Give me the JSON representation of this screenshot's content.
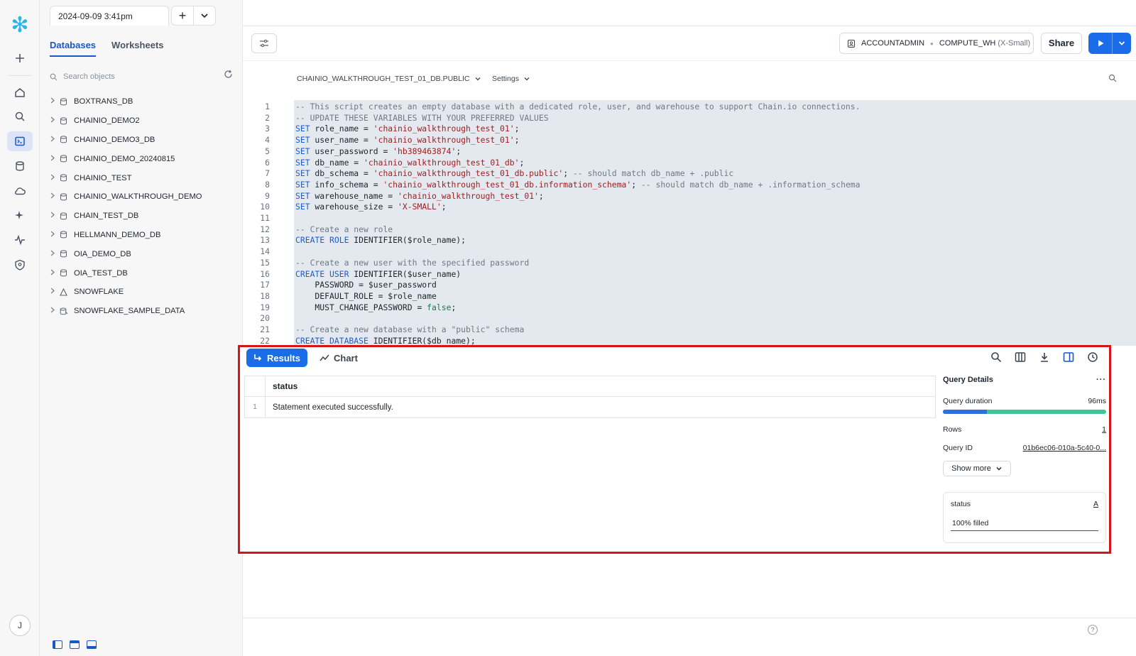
{
  "worksheet_tab": "2024-09-09 3:41pm",
  "sidebar": {
    "tabs": [
      "Databases",
      "Worksheets"
    ],
    "search_placeholder": "Search objects",
    "databases": [
      "BOXTRANS_DB",
      "CHAINIO_DEMO2",
      "CHAINIO_DEMO3_DB",
      "CHAINIO_DEMO_20240815",
      "CHAINIO_TEST",
      "CHAINIO_WALKTHROUGH_DEMO",
      "CHAIN_TEST_DB",
      "HELLMANN_DEMO_DB",
      "OIA_DEMO_DB",
      "OIA_TEST_DB",
      "SNOWFLAKE",
      "SNOWFLAKE_SAMPLE_DATA"
    ]
  },
  "toolbar": {
    "role": "ACCOUNTADMIN",
    "warehouse": "COMPUTE_WH",
    "warehouse_size": "(X-Small)",
    "share_label": "Share"
  },
  "editor": {
    "context": "CHAINIO_WALKTHROUGH_TEST_01_DB.PUBLIC",
    "settings_label": "Settings",
    "lines": [
      [
        [
          "cm",
          "-- This script creates an empty database with a dedicated role, user, and warehouse to support Chain.io connections."
        ]
      ],
      [
        [
          "cm",
          "-- UPDATE THESE VARIABLES WITH YOUR PREFERRED VALUES"
        ]
      ],
      [
        [
          "kw",
          "SET"
        ],
        [
          "id",
          " role_name = "
        ],
        [
          "st",
          "'chainio_walkthrough_test_01'"
        ],
        [
          "id",
          ";"
        ]
      ],
      [
        [
          "kw",
          "SET"
        ],
        [
          "id",
          " user_name = "
        ],
        [
          "st",
          "'chainio_walkthrough_test_01'"
        ],
        [
          "id",
          ";"
        ]
      ],
      [
        [
          "kw",
          "SET"
        ],
        [
          "id",
          " user_password = "
        ],
        [
          "st",
          "'hb389463874'"
        ],
        [
          "id",
          ";"
        ]
      ],
      [
        [
          "kw",
          "SET"
        ],
        [
          "id",
          " db_name = "
        ],
        [
          "st",
          "'chainio_walkthrough_test_01_db'"
        ],
        [
          "id",
          ";"
        ]
      ],
      [
        [
          "kw",
          "SET"
        ],
        [
          "id",
          " db_schema = "
        ],
        [
          "st",
          "'chainio_walkthrough_test_01_db.public'"
        ],
        [
          "id",
          "; "
        ],
        [
          "cm",
          "-- should match db_name + .public"
        ]
      ],
      [
        [
          "kw",
          "SET"
        ],
        [
          "id",
          " info_schema = "
        ],
        [
          "st",
          "'chainio_walkthrough_test_01_db.information_schema'"
        ],
        [
          "id",
          "; "
        ],
        [
          "cm",
          "-- should match db_name + .information_schema"
        ]
      ],
      [
        [
          "kw",
          "SET"
        ],
        [
          "id",
          " warehouse_name = "
        ],
        [
          "st",
          "'chainio_walkthrough_test_01'"
        ],
        [
          "id",
          ";"
        ]
      ],
      [
        [
          "kw",
          "SET"
        ],
        [
          "id",
          " warehouse_size = "
        ],
        [
          "st",
          "'X-SMALL'"
        ],
        [
          "id",
          ";"
        ]
      ],
      [],
      [
        [
          "cm",
          "-- Create a new role"
        ]
      ],
      [
        [
          "kw",
          "CREATE ROLE"
        ],
        [
          "id",
          " IDENTIFIER($role_name);"
        ]
      ],
      [],
      [
        [
          "cm",
          "-- Create a new user with the specified password"
        ]
      ],
      [
        [
          "kw",
          "CREATE USER"
        ],
        [
          "id",
          " IDENTIFIER($user_name)"
        ]
      ],
      [
        [
          "id",
          "    PASSWORD = $user_password"
        ]
      ],
      [
        [
          "id",
          "    DEFAULT_ROLE = $role_name"
        ]
      ],
      [
        [
          "id",
          "    MUST_CHANGE_PASSWORD = "
        ],
        [
          "bl",
          "false"
        ],
        [
          "id",
          ";"
        ]
      ],
      [],
      [
        [
          "cm",
          "-- Create a new database with a \"public\" schema"
        ]
      ],
      [
        [
          "kw",
          "CREATE DATABASE"
        ],
        [
          "id",
          " IDENTIFIER($db_name);"
        ]
      ]
    ]
  },
  "results": {
    "results_label": "Results",
    "chart_label": "Chart",
    "columns": [
      "status"
    ],
    "rows": [
      [
        "1",
        "Statement executed successfully."
      ]
    ],
    "details": {
      "title": "Query Details",
      "duration_label": "Query duration",
      "duration_value": "96ms",
      "duration_split": 0.27,
      "rows_label": "Rows",
      "rows_value": "1",
      "query_id_label": "Query ID",
      "query_id_value": "01b6ec06-010a-5c40-0...",
      "show_more": "Show more"
    },
    "column_card": {
      "name": "status",
      "type_icon": "A",
      "filled": "100% filled"
    }
  },
  "user_initial": "J"
}
